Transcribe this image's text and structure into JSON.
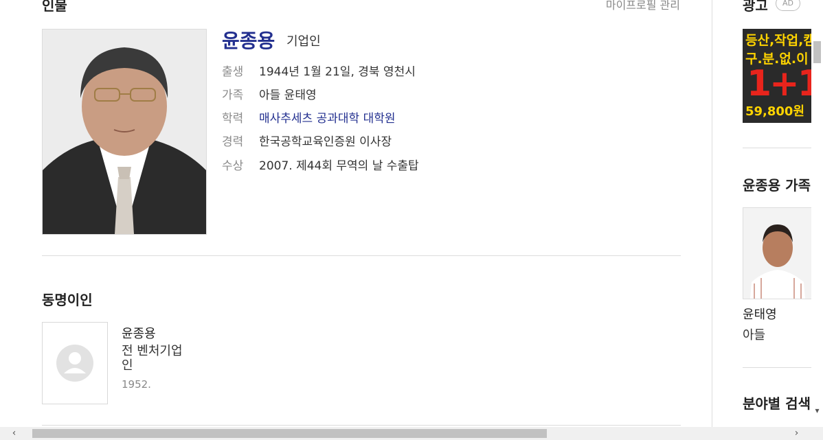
{
  "section": {
    "title": "인물",
    "manage_link": "마이프로필 관리"
  },
  "person": {
    "name": "윤종용",
    "job": "기업인",
    "info": [
      {
        "key": "출생",
        "value": "1944년 1월 21일, 경북 영천시"
      },
      {
        "key": "가족",
        "value": "아들 윤태영"
      },
      {
        "key": "학력",
        "value": "매사추세츠 공과대학 대학원"
      },
      {
        "key": "경력",
        "value": "한국공학교육인증원 이사장"
      },
      {
        "key": "수상",
        "value": "2007. 제44회 무역의 날 수출탑"
      }
    ]
  },
  "same_name": {
    "title": "동명이인",
    "items": [
      {
        "name": "윤종용",
        "desc": "전 벤처기업인",
        "year": "1952."
      }
    ]
  },
  "sidebar": {
    "ad_title": "광고",
    "ad_badge": "AD",
    "ad_banner": {
      "line1": "등산,작업,캠",
      "line2": "구.분.없.이",
      "offer": "1+1",
      "price": "59,800원"
    },
    "family_title": "윤종용 가족",
    "family_member": {
      "name": "윤태영",
      "relation": "아들"
    },
    "field_search_title": "분야별 검색"
  },
  "colors": {
    "link": "#222f8f",
    "muted": "#8a8a8a",
    "ad_yellow": "#ffd400",
    "ad_red": "#e8241c"
  },
  "icons": {
    "scroll_down": "chevron-down-icon",
    "scroll_left": "chevron-left-icon",
    "scroll_right": "chevron-right-icon",
    "placeholder": "user-placeholder-icon"
  }
}
